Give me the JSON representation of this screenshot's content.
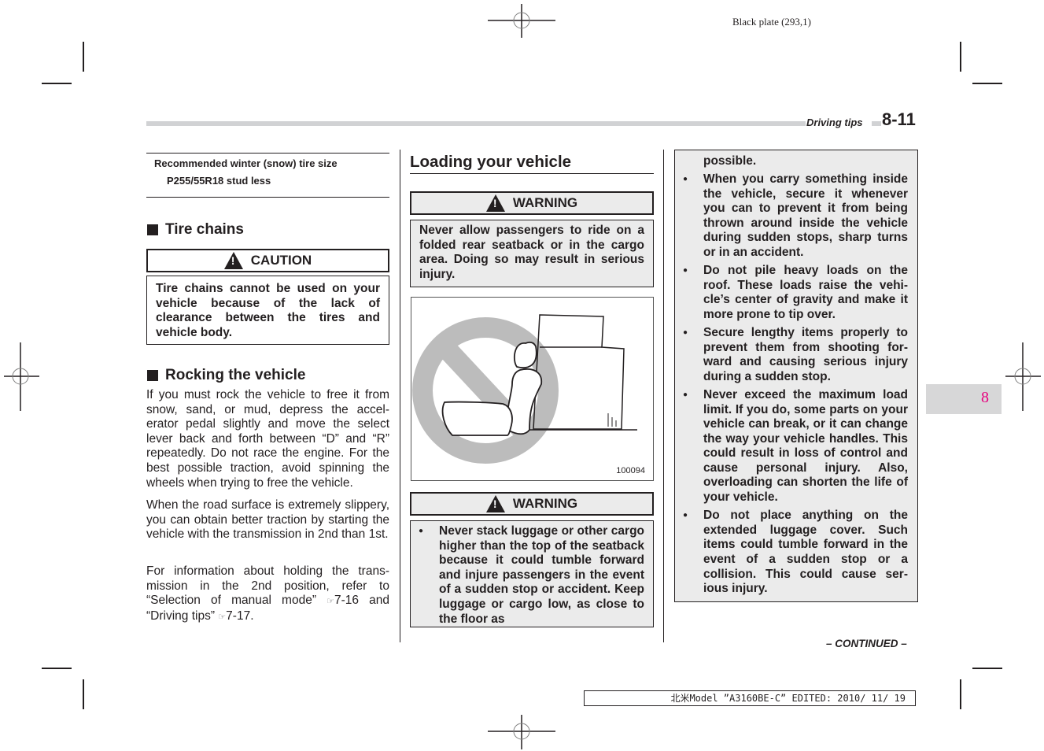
{
  "header": {
    "plate_label": "Black plate (293,1)",
    "section_title": "Driving tips",
    "page_number": "8-11"
  },
  "left_column": {
    "tire_spec": {
      "title": "Recommended winter (snow) tire size",
      "value": "P255/55R18 stud less"
    },
    "tire_chains": {
      "heading": "Tire chains",
      "caution_label": "CAUTION",
      "caution_text": "Tire chains cannot be used on your vehicle because of the lack of clearance between the tires and vehicle body."
    },
    "rocking": {
      "heading": "Rocking the vehicle",
      "para1": "If you must rock the vehicle to free it from snow, sand, or mud, depress the accel-erator pedal slightly and move the select lever back and forth between “D” and “R” repeatedly. Do not race the engine. For the best possible traction, avoid spinning the wheels when trying to free the vehicle.",
      "para2": "When the road surface is extremely slippery, you can obtain better traction by starting the vehicle with the transmission in 2nd than 1st.",
      "para3_pre": "For information about holding the trans-mission in the 2nd position, refer to “Selection of manual mode” ",
      "ref1": "7-16",
      "para3_mid": " and “Driving tips” ",
      "ref2": "7-17",
      "para3_end": ".",
      "ref_icon": "☞"
    }
  },
  "middle_column": {
    "heading": "Loading your vehicle",
    "warning1_label": "WARNING",
    "warning1_text": "Never allow passengers to ride on a folded rear seatback or in the cargo area. Doing so may result in serious injury.",
    "figure_id": "100094",
    "warning2_label": "WARNING",
    "warning2_items": [
      "Never stack luggage or other cargo higher than the top of the seatback because it could tumble forward and injure passengers in the event of a sudden stop or accident. Keep luggage or cargo low, as close to the floor as"
    ]
  },
  "right_column": {
    "continuation": "possible.",
    "items": [
      "When you carry something inside the vehicle, secure it whenever you can to prevent it from being thrown around inside the vehicle during sudden stops, sharp turns or in an accident.",
      "Do not pile heavy loads on the roof. These loads raise the vehi-cle’s center of gravity and make it more prone to tip over.",
      "Secure lengthy items properly to prevent them from shooting for-ward and causing serious injury during a sudden stop.",
      "Never exceed the maximum load limit. If you do, some parts on your vehicle can break, or it can change the way your vehicle handles. This could result in loss of control and cause personal injury. Also, overloading can shorten the life of your vehicle.",
      "Do not place anything on the extended luggage cover. Such items could tumble forward in the event of a sudden stop or a collision. This could cause ser-ious injury."
    ],
    "continued_label": "– CONTINUED –"
  },
  "chapter_tab": "8",
  "footer": {
    "edit_info": "北米Model ”A3160BE-C” EDITED: 2010/ 11/ 19"
  },
  "colors": {
    "chapter_tab_text": "#e6007e",
    "warning_bg": "#ebebeb",
    "header_bar": "#d1d2d4"
  }
}
